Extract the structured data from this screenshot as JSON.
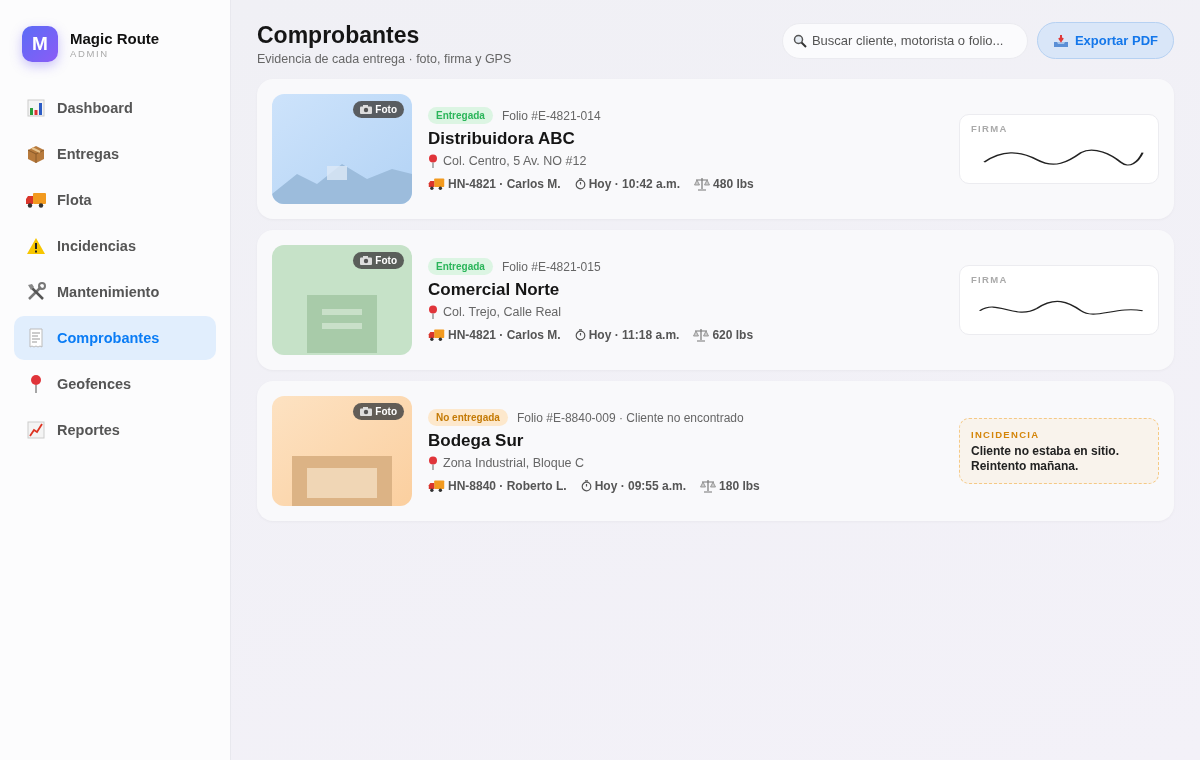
{
  "app": {
    "logo_letter": "M",
    "name": "Magic Route",
    "role": "ADMIN"
  },
  "sidebar": {
    "items": [
      {
        "label": "Dashboard",
        "kind": "chart",
        "selected": false
      },
      {
        "label": "Entregas",
        "kind": "package",
        "selected": false
      },
      {
        "label": "Flota",
        "kind": "truck",
        "selected": false
      },
      {
        "label": "Incidencias",
        "kind": "warning",
        "selected": false
      },
      {
        "label": "Mantenimiento",
        "kind": "tools",
        "selected": false
      },
      {
        "label": "Comprobantes",
        "kind": "receipt",
        "selected": true
      },
      {
        "label": "Geofences",
        "kind": "pin",
        "selected": false
      },
      {
        "label": "Reportes",
        "kind": "trend",
        "selected": false
      }
    ]
  },
  "header": {
    "title": "Comprobantes",
    "subtitle": "Evidencia de cada entrega · foto, firma y GPS"
  },
  "search": {
    "placeholder": "Buscar cliente, motorista o folio..."
  },
  "export_button": {
    "label": "Exportar PDF"
  },
  "deliveries": [
    {
      "status": "Entregada",
      "kind": "delivered",
      "folio": "Folio #E-4821-014",
      "name": "Distribuidora ABC",
      "address": "Col. Centro, 5 Av. NO #12",
      "vehicle": "HN-4821 · Carlos M.",
      "time": "Hoy · 10:42 a.m.",
      "weight": "480 lbs",
      "photo_label": "Foto",
      "proof": {
        "kind": "signature",
        "label": "FIRMA"
      }
    },
    {
      "status": "Entregada",
      "kind": "delivered",
      "folio": "Folio #E-4821-015",
      "name": "Comercial Norte",
      "address": "Col. Trejo, Calle Real",
      "vehicle": "HN-4821 · Carlos M.",
      "time": "Hoy · 11:18 a.m.",
      "weight": "620 lbs",
      "photo_label": "Foto",
      "proof": {
        "kind": "signature",
        "label": "FIRMA"
      }
    },
    {
      "status": "No entregada",
      "kind": "failed",
      "folio": "Folio #E-8840-009 · Cliente no encontrado",
      "name": "Bodega Sur",
      "address": "Zona Industrial, Bloque C",
      "vehicle": "HN-8840 · Roberto L.",
      "time": "Hoy · 09:55 a.m.",
      "weight": "180 lbs",
      "photo_label": "Foto",
      "proof": {
        "kind": "incident",
        "label": "INCIDENCIA",
        "text": "Cliente no estaba en sitio. Reintento mañana."
      }
    }
  ]
}
